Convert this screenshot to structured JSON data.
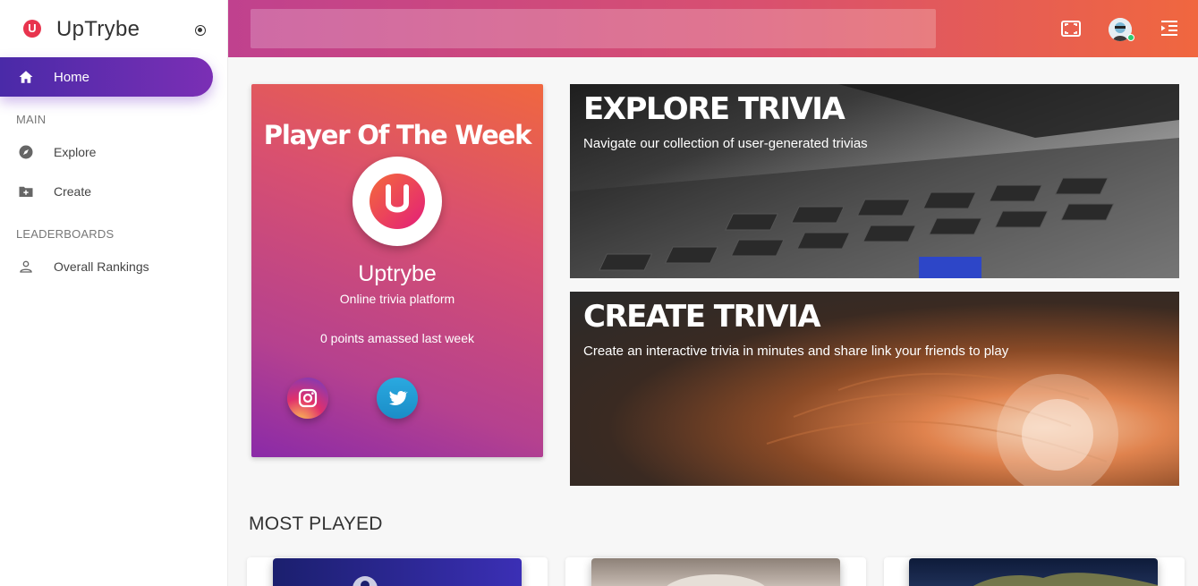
{
  "brand": {
    "logo_letter": "U",
    "name": "UpTrybe"
  },
  "sidebar": {
    "home_label": "Home",
    "sections": [
      {
        "label": "MAIN",
        "items": [
          {
            "label": "Explore",
            "icon": "compass-icon"
          },
          {
            "label": "Create",
            "icon": "folder-plus-icon"
          }
        ]
      },
      {
        "label": "LEADERBOARDS",
        "items": [
          {
            "label": "Overall Rankings",
            "icon": "user-icon"
          }
        ]
      }
    ]
  },
  "header": {
    "search_value": "",
    "icons": [
      "fullscreen-icon",
      "avatar",
      "menu-collapse-icon"
    ]
  },
  "player_card": {
    "title": "Player Of The Week",
    "name": "Uptrybe",
    "subtitle": "Online trivia platform",
    "points": "0 points amassed last week",
    "socials": [
      "instagram-icon",
      "twitter-icon"
    ]
  },
  "banners": {
    "explore": {
      "title": "EXPLORE TRIVIA",
      "text": "Navigate our collection of user-generated trivias"
    },
    "create": {
      "title": "CREATE TRIVIA",
      "text": "Create an interactive trivia in minutes and share link your friends to play"
    }
  },
  "most_played": {
    "title": "MOST PLAYED"
  },
  "colors": {
    "header_start": "#c0418e",
    "header_end": "#f0673f",
    "home_active": "#5a2ab0",
    "brand_red": "#e8344e"
  }
}
